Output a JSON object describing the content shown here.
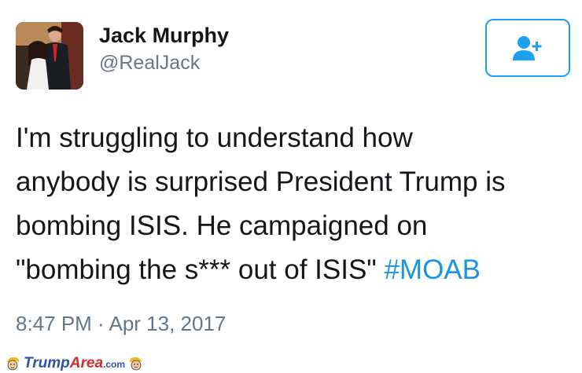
{
  "author": {
    "display_name": "Jack Murphy",
    "handle": "@RealJack"
  },
  "follow_button": {
    "icon": "follow-person-plus-icon",
    "color": "#1da1f2"
  },
  "tweet": {
    "lines": [
      "I'm struggling to understand how",
      "anybody is surprised President Trump is",
      "bombing ISIS. He campaigned on",
      "\"bombing the s*** out of ISIS\" "
    ],
    "hashtag": "#MOAB",
    "hashtag_color": "#1b95e0",
    "timestamp": "8:47 PM · Apr 13, 2017"
  },
  "watermark": {
    "text_trump": "Trump",
    "text_area": "Area",
    "text_com": ".com",
    "icon": "trump-face-icon"
  }
}
